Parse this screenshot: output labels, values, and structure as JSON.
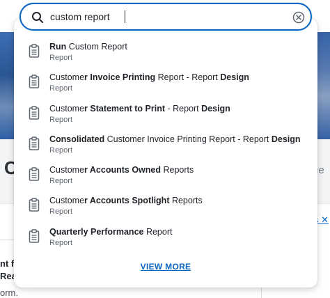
{
  "search": {
    "value": "custom report",
    "placeholder": ""
  },
  "results": [
    {
      "parts": [
        {
          "t": "Run",
          "b": true
        },
        {
          "t": " Custom Report",
          "b": false
        }
      ],
      "type": "Report"
    },
    {
      "parts": [
        {
          "t": "Custome",
          "b": false
        },
        {
          "t": "r Invoice Printing",
          "b": true
        },
        {
          "t": " Report - Report ",
          "b": false
        },
        {
          "t": "Design",
          "b": true
        }
      ],
      "type": "Report"
    },
    {
      "parts": [
        {
          "t": "Custome",
          "b": false
        },
        {
          "t": "r Statement to Print",
          "b": true
        },
        {
          "t": " - Report ",
          "b": false
        },
        {
          "t": "Design",
          "b": true
        }
      ],
      "type": "Report"
    },
    {
      "parts": [
        {
          "t": "Consolidated",
          "b": true
        },
        {
          "t": " Custome",
          "b": false
        },
        {
          "t": "r Invoice Printing",
          "b": false
        },
        {
          "t": " Report - Report ",
          "b": false
        },
        {
          "t": "Design",
          "b": true
        }
      ],
      "type": "Report"
    },
    {
      "parts": [
        {
          "t": "Custome",
          "b": false
        },
        {
          "t": "r Accounts Owned",
          "b": true
        },
        {
          "t": " Reports",
          "b": false
        }
      ],
      "type": "Report"
    },
    {
      "parts": [
        {
          "t": "Custome",
          "b": false
        },
        {
          "t": "r Accounts Spotlight",
          "b": true
        },
        {
          "t": " Reports",
          "b": false
        }
      ],
      "type": "Report"
    },
    {
      "parts": [
        {
          "t": "Quarterly Performance",
          "b": true
        },
        {
          "t": " Report",
          "b": false
        }
      ],
      "type": "Report"
    }
  ],
  "view_more_label": "VIEW MORE",
  "background": {
    "big_letter": "C",
    "right_text": "ue",
    "right_link": "s ✕",
    "left_line_1": "nt f",
    "left_line_2": "Rea",
    "left_line_3": "orm."
  },
  "colors": {
    "accent": "#0b65c2",
    "banner": "#2f5fa6",
    "panel": "#f3f4f6"
  },
  "icons": {
    "search": "search-icon",
    "clear": "clear-circle-x-icon",
    "result": "report-clipboard-icon"
  }
}
